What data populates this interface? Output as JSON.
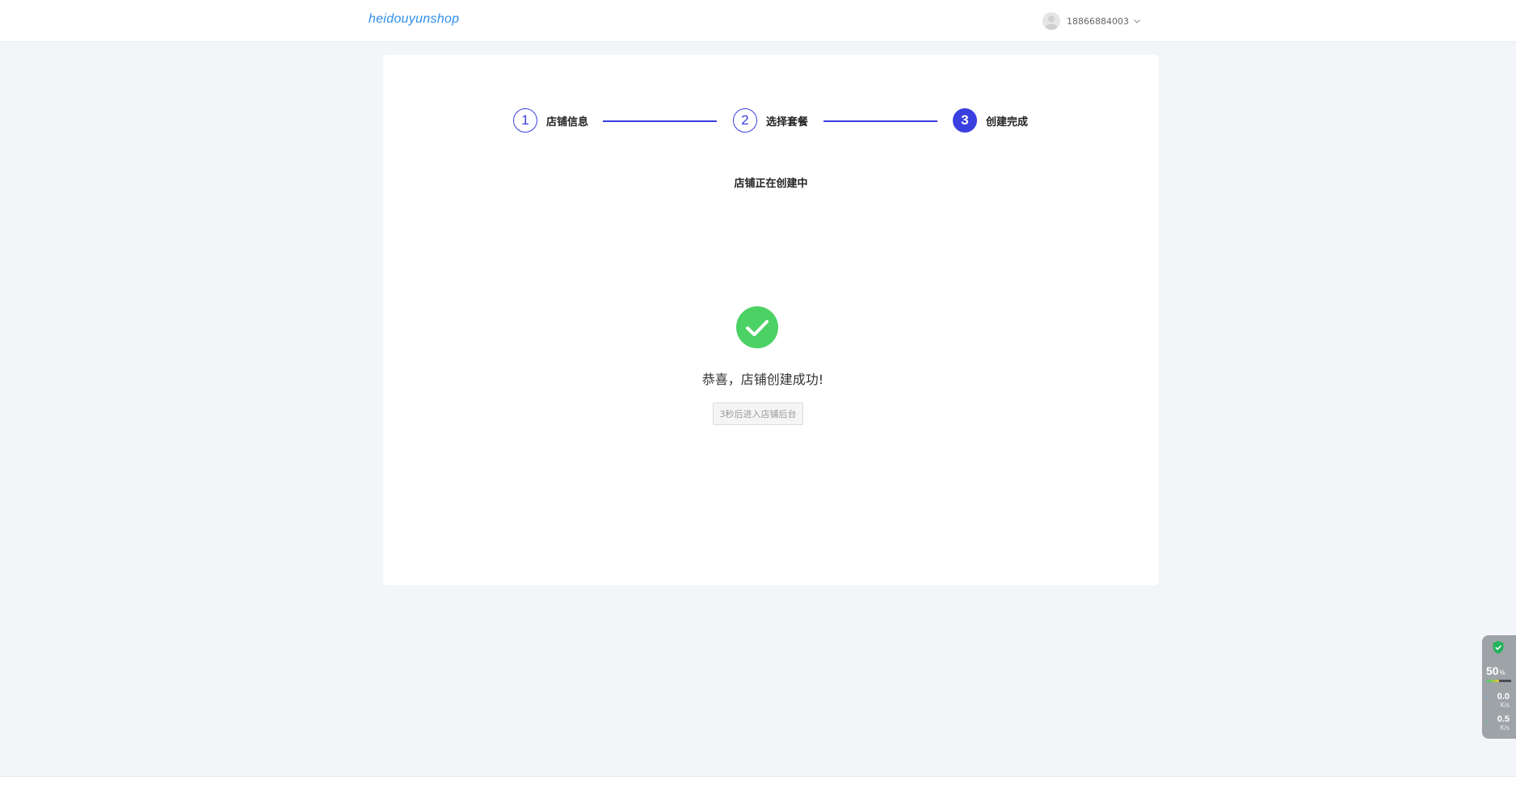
{
  "header": {
    "logo_text": "heidouyunshop",
    "user_phone": "18866884003"
  },
  "steps": [
    {
      "number": "1",
      "label": "店铺信息",
      "state": "done"
    },
    {
      "number": "2",
      "label": "选择套餐",
      "state": "done"
    },
    {
      "number": "3",
      "label": "创建完成",
      "state": "active"
    }
  ],
  "main": {
    "status_title": "店铺正在创建中",
    "success_message": "恭喜，店铺创建成功!",
    "redirect_button": "3秒后进入店铺后台"
  },
  "colors": {
    "accent": "#3a3fe0",
    "success": "#4cd164",
    "logo": "#2e8fee"
  },
  "widget": {
    "percent": "50",
    "percent_unit": "%",
    "upload": "0.0",
    "upload_unit": "K/s",
    "download": "0.5",
    "download_unit": "K/s"
  },
  "icons": {
    "avatar": "avatar-icon",
    "chevron": "chevron-down-icon",
    "success": "check-circle-icon",
    "shield": "shield-check-icon"
  }
}
